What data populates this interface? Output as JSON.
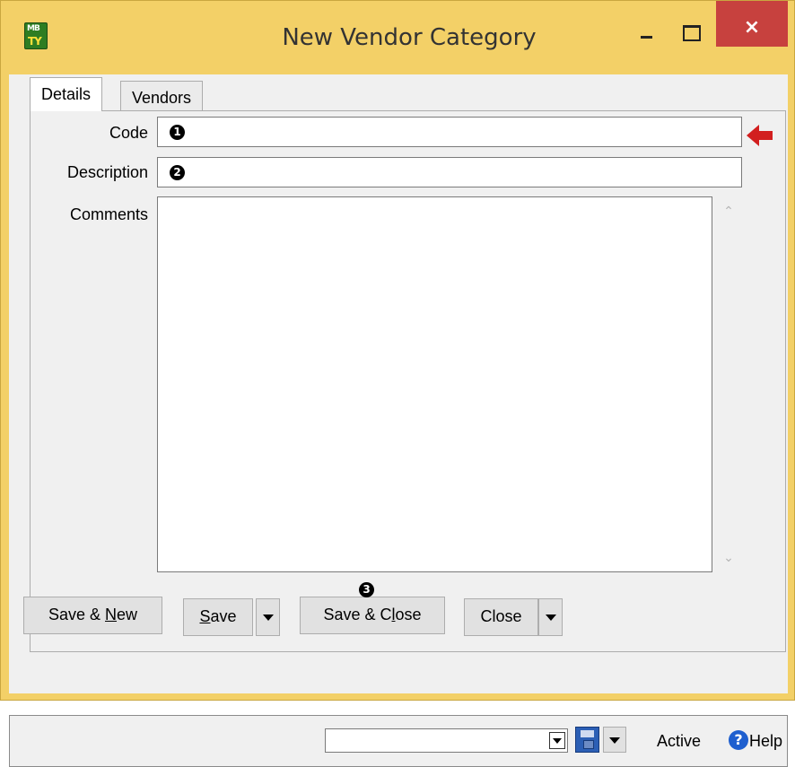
{
  "window": {
    "title": "New Vendor Category",
    "icon_text_top": "MB",
    "icon_text_bottom": "TY",
    "close_glyph": "×"
  },
  "tabs": [
    {
      "label": "Details",
      "active": true
    },
    {
      "label": "Vendors",
      "active": false
    }
  ],
  "form": {
    "code_label": "Code",
    "code_value": "",
    "code_marker": "1",
    "description_label": "Description",
    "description_value": "",
    "description_marker": "2",
    "comments_label": "Comments",
    "comments_value": "",
    "required_icon": "required-arrow-icon"
  },
  "buttons": {
    "save_new": {
      "prefix": "Save & ",
      "accel": "N",
      "suffix": "ew"
    },
    "save": {
      "prefix": "",
      "accel": "S",
      "suffix": "ave"
    },
    "save_close": {
      "prefix": "Save & C",
      "accel": "l",
      "suffix": "ose"
    },
    "save_close_marker": "3",
    "close": {
      "label": "Close"
    }
  },
  "statusbar": {
    "combo_value": "",
    "active_label": "Active",
    "help_label": "Help",
    "help_glyph": "?"
  },
  "colors": {
    "frame": "#f3d067",
    "close_button": "#c7413e",
    "required_arrow": "#d21f1f",
    "help_icon": "#1e5fcf"
  }
}
